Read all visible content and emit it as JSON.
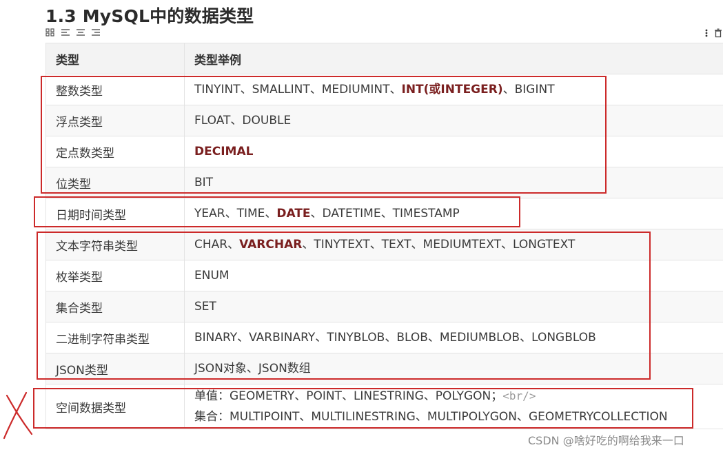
{
  "heading": "1.3 MySQL中的数据类型",
  "toolbar_icons": [
    "grid-icon",
    "align-left-icon",
    "align-center-icon",
    "align-right-icon"
  ],
  "table": {
    "headers": [
      "类型",
      "类型举例"
    ],
    "rows": [
      {
        "type": "整数类型",
        "examples": [
          [
            {
              "t": "TINYINT、SMALLINT、MEDIUMINT、"
            },
            {
              "t": "INT(或INTEGER)",
              "hl": true
            },
            {
              "t": "、BIGINT"
            }
          ]
        ]
      },
      {
        "type": "浮点类型",
        "examples": [
          [
            {
              "t": "FLOAT、DOUBLE"
            }
          ]
        ]
      },
      {
        "type": "定点数类型",
        "examples": [
          [
            {
              "t": "DECIMAL",
              "hl": true
            }
          ]
        ]
      },
      {
        "type": "位类型",
        "examples": [
          [
            {
              "t": "BIT"
            }
          ]
        ]
      },
      {
        "type": "日期时间类型",
        "examples": [
          [
            {
              "t": "YEAR、TIME、"
            },
            {
              "t": "DATE",
              "hl": true
            },
            {
              "t": "、DATETIME、TIMESTAMP"
            }
          ]
        ]
      },
      {
        "type": "文本字符串类型",
        "examples": [
          [
            {
              "t": "CHAR、"
            },
            {
              "t": "VARCHAR",
              "hl": true
            },
            {
              "t": "、TINYTEXT、TEXT、MEDIUMTEXT、LONGTEXT"
            }
          ]
        ]
      },
      {
        "type": "枚举类型",
        "examples": [
          [
            {
              "t": "ENUM"
            }
          ]
        ]
      },
      {
        "type": "集合类型",
        "examples": [
          [
            {
              "t": "SET"
            }
          ]
        ]
      },
      {
        "type": "二进制字符串类型",
        "examples": [
          [
            {
              "t": "BINARY、VARBINARY、TINYBLOB、BLOB、MEDIUMBLOB、LONGBLOB"
            }
          ]
        ]
      },
      {
        "type": "JSON类型",
        "examples": [
          [
            {
              "t": "JSON对象、JSON数组"
            }
          ]
        ]
      },
      {
        "type": "空间数据类型",
        "examples": [
          [
            {
              "t": "单值：GEOMETRY、POINT、LINESTRING、POLYGON；"
            },
            {
              "t": "<br/>",
              "tag": true
            }
          ],
          [
            {
              "t": "集合：MULTIPOINT、MULTILINESTRING、MULTIPOLYGON、GEOMETRYCOLLECTION"
            }
          ]
        ]
      }
    ]
  },
  "colors": {
    "highlight": "#7a1f1f",
    "annotation_red": "#cc2a2a",
    "header_bg": "#f3f3f3"
  },
  "watermark": "CSDN @啥好吃的啊给我来一口"
}
